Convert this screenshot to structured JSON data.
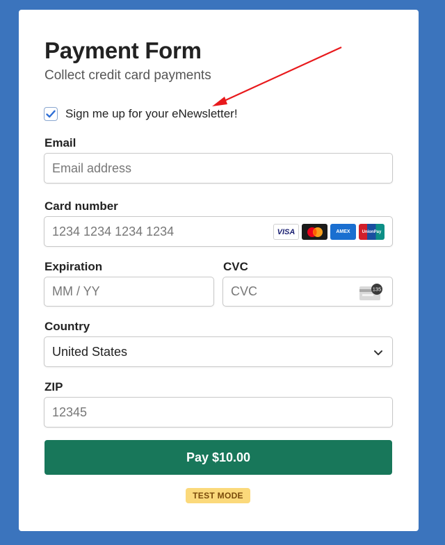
{
  "form": {
    "title": "Payment Form",
    "subtitle": "Collect credit card payments"
  },
  "newsletter": {
    "label": "Sign me up for your eNewsletter!",
    "checked": true
  },
  "email": {
    "label": "Email",
    "placeholder": "Email address"
  },
  "card_number": {
    "label": "Card number",
    "placeholder": "1234 1234 1234 1234",
    "brands": [
      {
        "name": "VISA",
        "icon": "visa-icon"
      },
      {
        "name": "Mastercard",
        "icon": "mastercard-icon"
      },
      {
        "name": "AMEX",
        "icon": "amex-icon"
      },
      {
        "name": "UnionPay",
        "icon": "unionpay-icon"
      }
    ]
  },
  "expiration": {
    "label": "Expiration",
    "placeholder": "MM / YY"
  },
  "cvc": {
    "label": "CVC",
    "placeholder": "CVC",
    "icon_digits": "135"
  },
  "country": {
    "label": "Country",
    "value": "United States"
  },
  "zip": {
    "label": "ZIP",
    "placeholder": "12345"
  },
  "pay_button": {
    "label": "Pay $10.00"
  },
  "test_mode": {
    "label": "TEST MODE"
  },
  "colors": {
    "background": "#3b74bd",
    "pay_button": "#18775a",
    "test_badge": "#fbd97b",
    "arrow": "#e8191c",
    "checkbox": "#2f6fd6"
  }
}
